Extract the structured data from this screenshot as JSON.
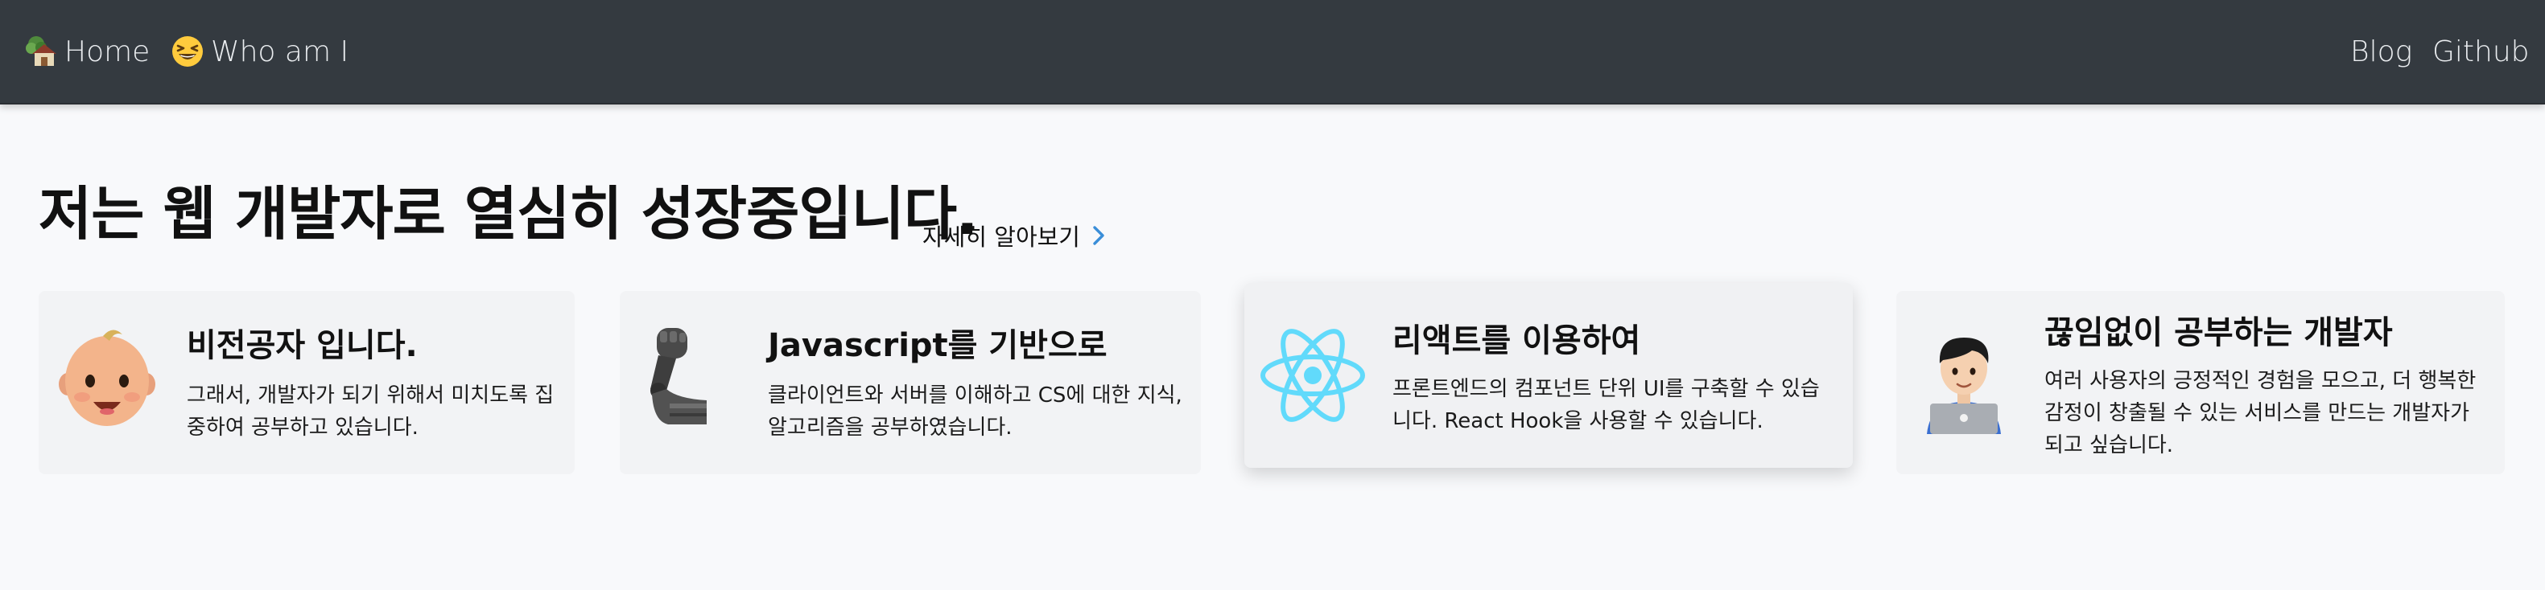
{
  "nav": {
    "home": {
      "icon": "house-with-garden-icon",
      "label": "Home"
    },
    "whoami": {
      "icon": "grinning-squinting-face-icon",
      "label": "Who am I"
    },
    "blog": "Blog",
    "github": "Github"
  },
  "hero": {
    "headline": "저는 웹 개발자로 열심히 성장중입니다.",
    "more_link": "자세히 알아보기",
    "more_icon": "chevron-right-icon"
  },
  "cards": [
    {
      "icon": "baby-icon",
      "title": "비전공자 입니다.",
      "desc": "그래서, 개발자가 되기 위해서 미치도록 집중하여 공부하고 있습니다."
    },
    {
      "icon": "mechanical-arm-icon",
      "title": "Javascript를 기반으로",
      "desc": "클라이언트와 서버를 이해하고 CS에 대한 지식, 알고리즘을 공부하였습니다."
    },
    {
      "icon": "react-logo-icon",
      "title": "리액트를 이용하여",
      "desc": "프론트엔드의 컴포넌트 단위 UI를 구축할 수 있습니다. React Hook을 사용할 수 있습니다."
    },
    {
      "icon": "technologist-icon",
      "title": "끊임없이 공부하는 개발자",
      "desc": "여러 사용자의 긍정적인 경험을 모으고, 더 행복한 감정이 창출될 수 있는 서비스를 만드는 개발자가 되고 싶습니다."
    }
  ],
  "colors": {
    "navbar": "#343a40",
    "page_bg": "#f8f9fb",
    "card_bg": "#f2f3f5",
    "accent": "#3a8ed8",
    "react": "#61dafb"
  }
}
